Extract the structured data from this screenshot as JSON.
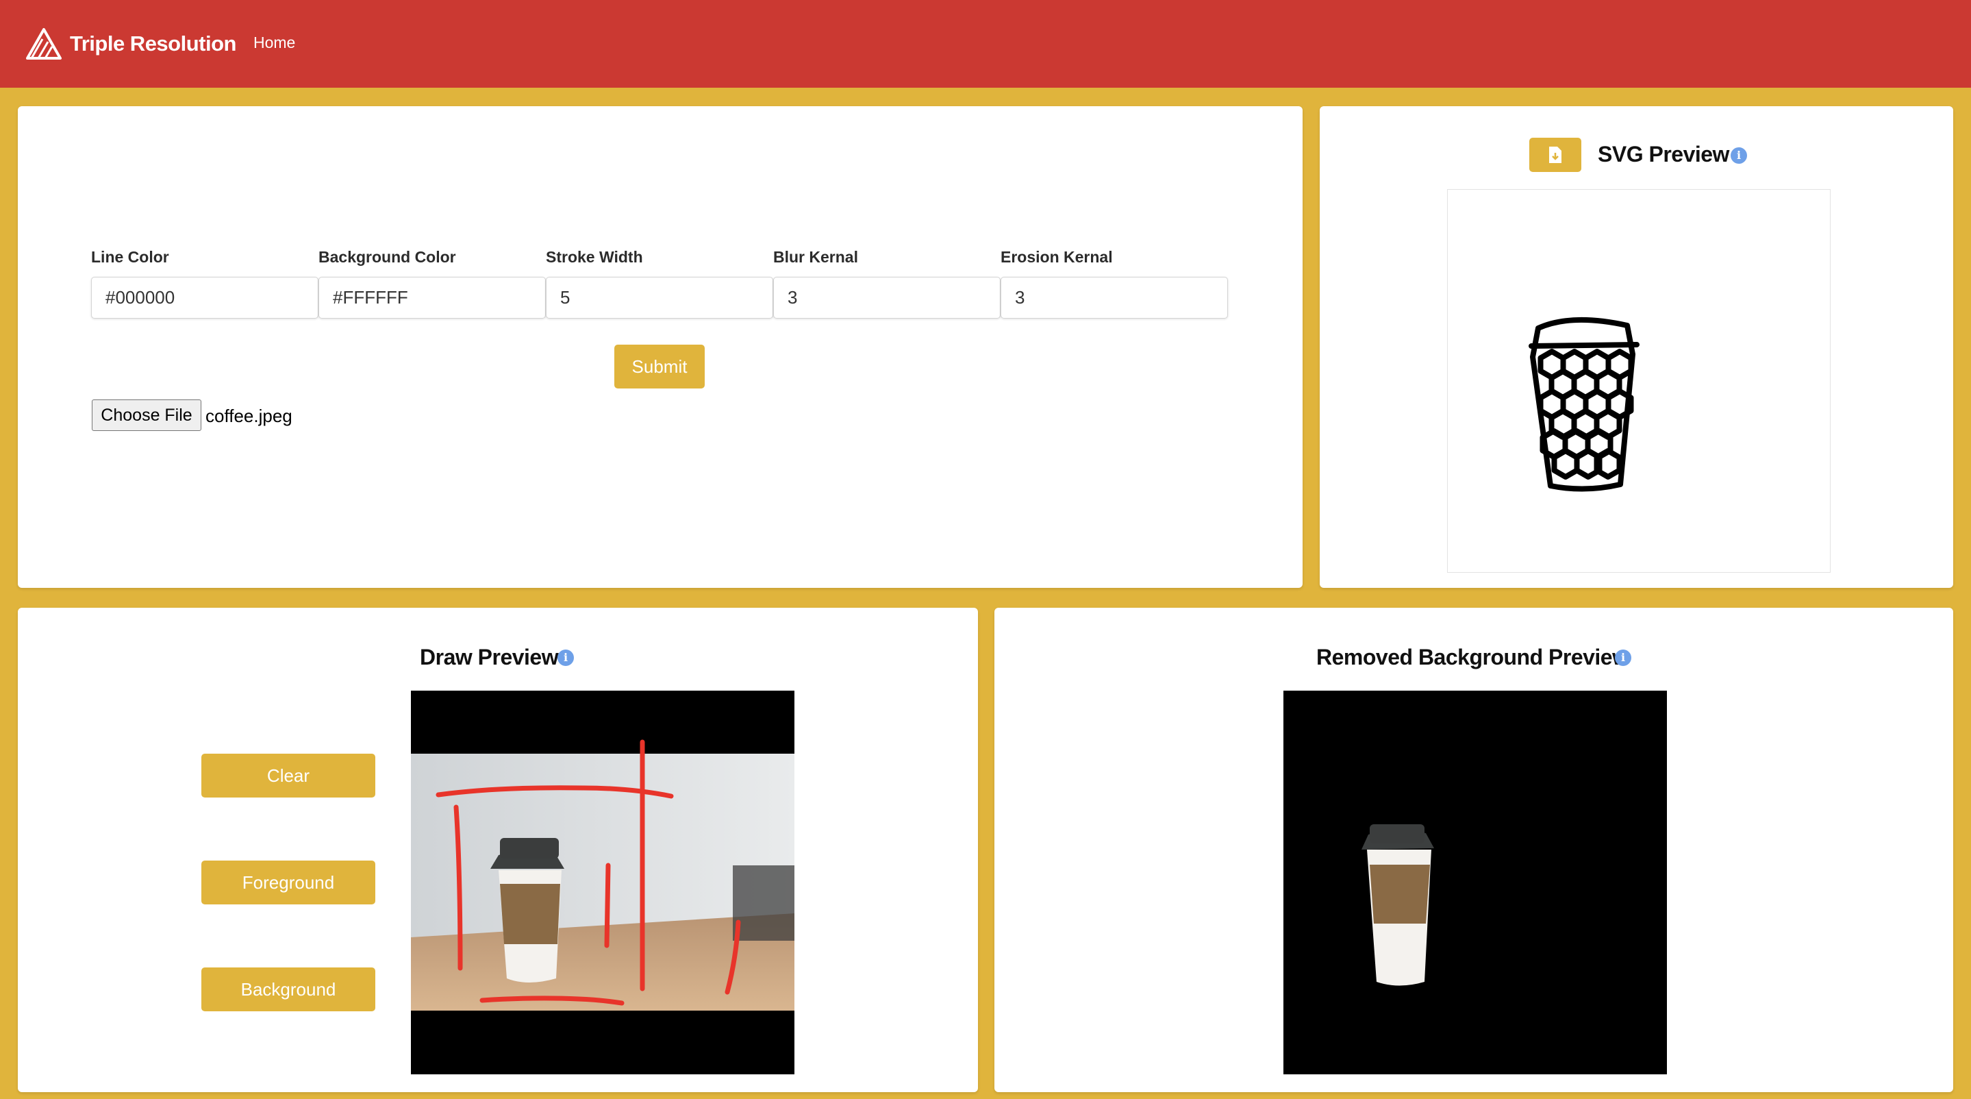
{
  "navbar": {
    "brand_name": "Triple Resolution",
    "home_link": "Home",
    "logo_icon": "mountain-logo-icon",
    "background_color": "#cb3932"
  },
  "theme": {
    "accent": "#e0b43c",
    "page_background": "#e0b43c"
  },
  "settings": {
    "fields": [
      {
        "label": "Line Color",
        "value": "#000000"
      },
      {
        "label": "Background Color",
        "value": "#FFFFFF"
      },
      {
        "label": "Stroke Width",
        "value": "5"
      },
      {
        "label": "Blur Kernal",
        "value": "3"
      },
      {
        "label": "Erosion Kernal",
        "value": "3"
      }
    ],
    "submit_label": "Submit",
    "choose_file_label": "Choose File",
    "file_name": "coffee.jpeg"
  },
  "svg_preview": {
    "title": "SVG Preview",
    "download_icon": "file-download-icon",
    "info_icon": "info-icon"
  },
  "draw_preview": {
    "title": "Draw Preview",
    "clear_label": "Clear",
    "foreground_label": "Foreground",
    "background_label": "Background",
    "stroke_color": "#e8342a",
    "info_icon": "info-icon"
  },
  "removed_preview": {
    "title": "Removed Background Preview",
    "info_icon": "info-icon"
  }
}
